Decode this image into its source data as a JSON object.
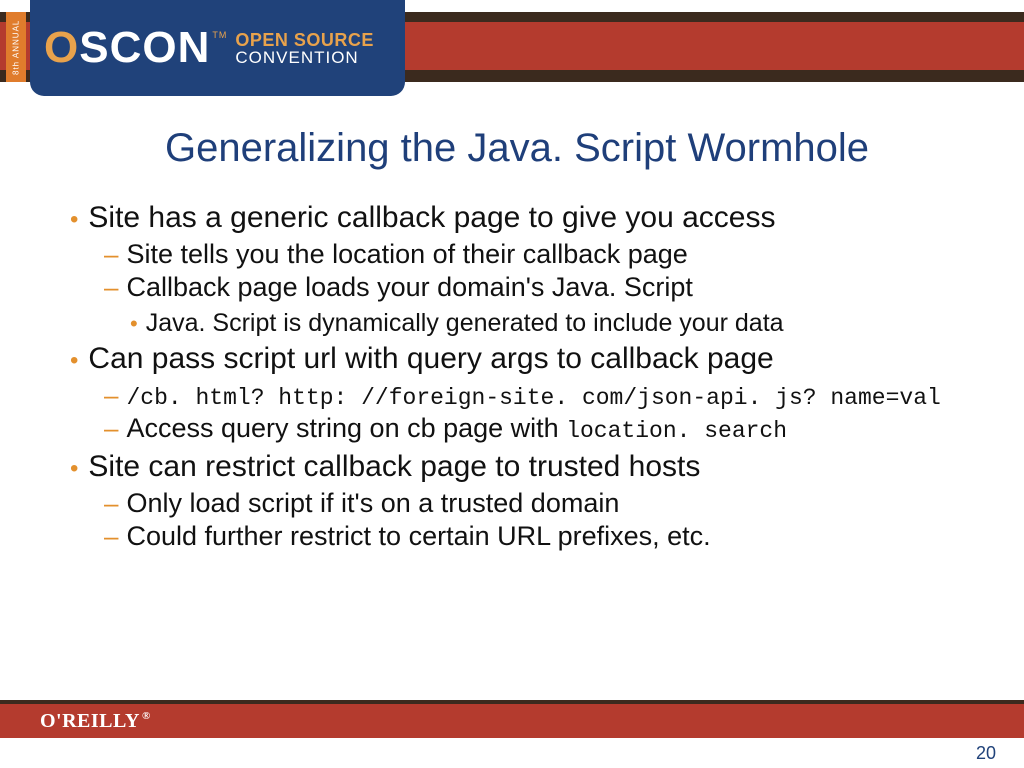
{
  "header": {
    "annual": "8th ANNUAL",
    "logo_word": "OSCON",
    "tm": "TM",
    "line1": "OPEN SOURCE",
    "line2": "CONVENTION"
  },
  "title": "Generalizing the Java. Script Wormhole",
  "bullets": [
    {
      "text": "Site has a generic callback page to give you access",
      "sub": [
        {
          "text": "Site tells you the location of their callback page"
        },
        {
          "text": "Callback page loads your domain's Java. Script",
          "sub": [
            {
              "text": "Java. Script is dynamically generated to include your data"
            }
          ]
        }
      ]
    },
    {
      "text": "Can pass script url with query args to callback page",
      "sub": [
        {
          "mono": true,
          "text": "/cb. html? http: //foreign-site. com/json-api. js? name=val"
        },
        {
          "text_pre": "Access query string on cb page with ",
          "text_mono": "location. search"
        }
      ]
    },
    {
      "text": "Site can restrict callback page to trusted hosts",
      "sub": [
        {
          "text": "Only load script if it's on a trusted domain"
        },
        {
          "text": "Could further restrict to certain URL prefixes, etc."
        }
      ]
    }
  ],
  "footer": {
    "brand": "O'REILLY",
    "reg": "®",
    "page": "20"
  }
}
